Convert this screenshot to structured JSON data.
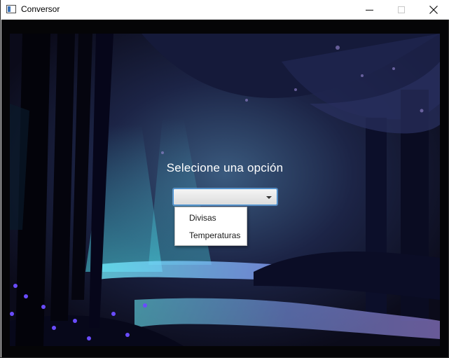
{
  "window": {
    "title": "Conversor",
    "controls": {
      "minimize": "minimize",
      "maximize": "maximize",
      "close": "close"
    }
  },
  "main": {
    "heading": "Selecione una opción",
    "combo": {
      "selected_value": "",
      "options": [
        "Divisas",
        "Temperaturas"
      ]
    }
  },
  "colors": {
    "accent_focus": "#3c8ed6",
    "background_dark": "#0b0b1a",
    "water_cyan": "#5ae0ff",
    "flower_purple": "#6a4cff"
  }
}
